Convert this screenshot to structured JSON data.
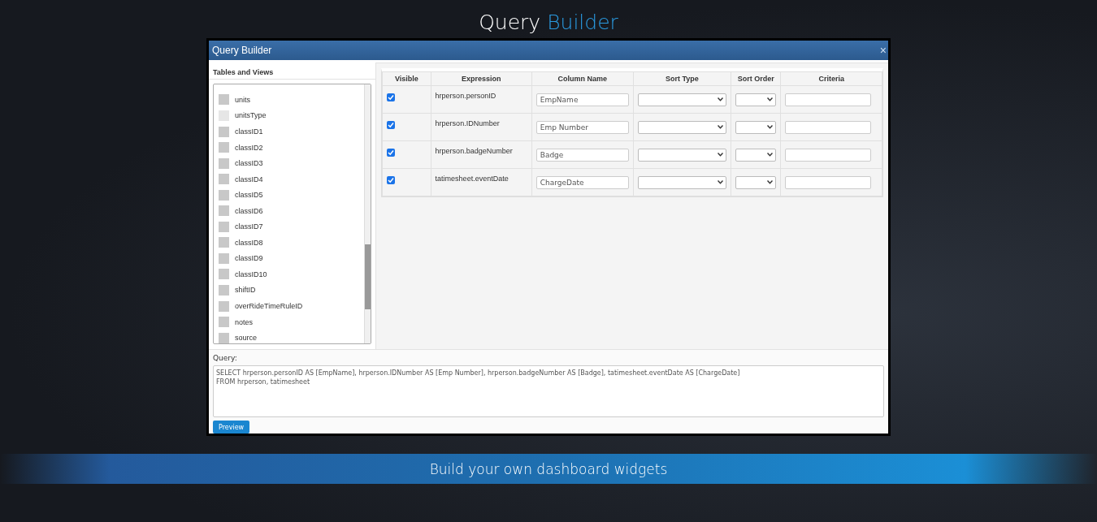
{
  "headline": {
    "first": "Query",
    "second": "Builder"
  },
  "dialog": {
    "title": "Query Builder",
    "close": "×",
    "fields_panel": {
      "title": "Tables and Views",
      "items": [
        {
          "label": "units",
          "checked": false,
          "disabled": false
        },
        {
          "label": "unitsType",
          "checked": false,
          "disabled": true
        },
        {
          "label": "classID1",
          "checked": false,
          "disabled": false
        },
        {
          "label": "classID2",
          "checked": false,
          "disabled": false
        },
        {
          "label": "classID3",
          "checked": false,
          "disabled": false
        },
        {
          "label": "classID4",
          "checked": false,
          "disabled": false
        },
        {
          "label": "classID5",
          "checked": false,
          "disabled": false
        },
        {
          "label": "classID6",
          "checked": false,
          "disabled": false
        },
        {
          "label": "classID7",
          "checked": false,
          "disabled": false
        },
        {
          "label": "classID8",
          "checked": false,
          "disabled": false
        },
        {
          "label": "classID9",
          "checked": false,
          "disabled": false
        },
        {
          "label": "classID10",
          "checked": false,
          "disabled": false
        },
        {
          "label": "shiftID",
          "checked": false,
          "disabled": false
        },
        {
          "label": "overRideTimeRuleID",
          "checked": false,
          "disabled": false
        },
        {
          "label": "notes",
          "checked": false,
          "disabled": false
        },
        {
          "label": "source",
          "checked": false,
          "disabled": false
        }
      ]
    },
    "grid": {
      "columns": [
        "Visible",
        "Expression",
        "Column Name",
        "Sort Type",
        "Sort Order",
        "Criteria"
      ],
      "rows": [
        {
          "visible": true,
          "expression": "hrperson.personID",
          "column_name": "EmpName"
        },
        {
          "visible": true,
          "expression": "hrperson.IDNumber",
          "column_name": "Emp Number"
        },
        {
          "visible": true,
          "expression": "hrperson.badgeNumber",
          "column_name": "Badge"
        },
        {
          "visible": true,
          "expression": "tatimesheet.eventDate",
          "column_name": "ChargeDate"
        }
      ]
    },
    "query": {
      "label": "Query:",
      "lines": [
        "SELECT hrperson.personID AS [EmpName], hrperson.IDNumber AS [Emp Number], hrperson.badgeNumber AS [Badge], tatimesheet.eventDate AS [ChargeDate]",
        "FROM hrperson, tatimesheet"
      ]
    },
    "preview_button": "Preview"
  },
  "banner": "Build your own dashboard widgets"
}
